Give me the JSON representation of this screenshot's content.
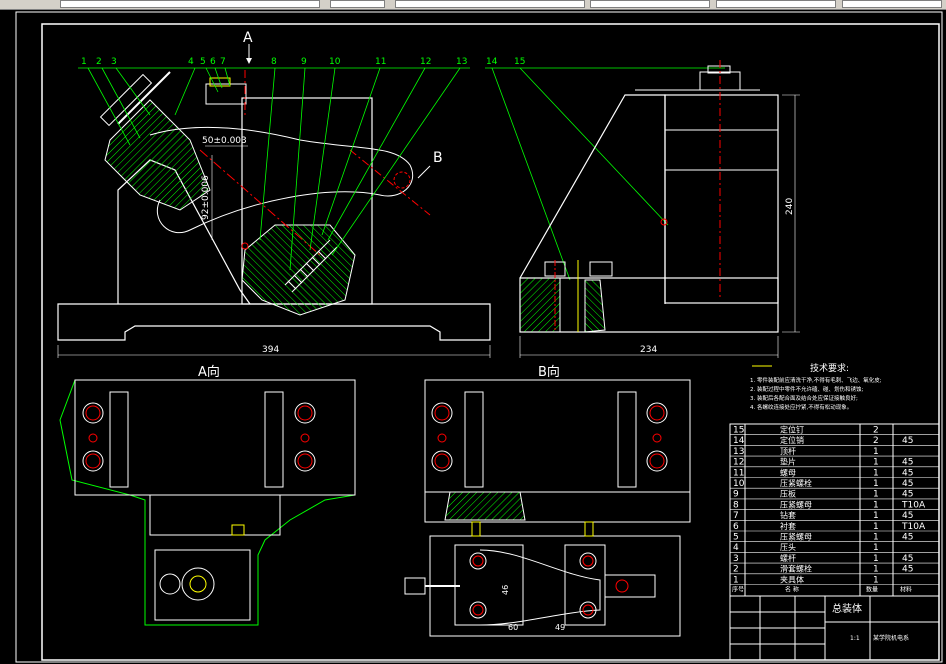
{
  "views": {
    "view_a_arrow_label": "A",
    "view_b_arrow_label": "B",
    "view_a_title": "A向",
    "view_b_title": "B向"
  },
  "balloons": [
    "1",
    "2",
    "3",
    "4",
    "5",
    "6",
    "7",
    "8",
    "9",
    "10",
    "11",
    "12",
    "13",
    "14",
    "15"
  ],
  "dimensions": {
    "front_width": "394",
    "side_width": "234",
    "side_height": "240",
    "lever_x": "50±0.003",
    "lever_y": "92±0.006",
    "b_view_46": "46",
    "b_view_60": "60",
    "b_view_49": "49"
  },
  "tech_requirements": {
    "title": "技术要求:",
    "lines": [
      "1. 零件装配前应清洗干净,不得有毛刺、飞边、氧化皮;",
      "2. 装配过程中零件不允许磕、碰、划伤和锈蚀;",
      "3. 装配后各配合面及结合处应保证接触良好;",
      "4. 各螺纹连接处应拧紧,不得有松动现象。"
    ]
  },
  "parts_list": {
    "rows": [
      {
        "no": "15",
        "name": "定位钉",
        "qty": "2",
        "mat": ""
      },
      {
        "no": "14",
        "name": "定位销",
        "qty": "2",
        "mat": "45"
      },
      {
        "no": "13",
        "name": "顶杆",
        "qty": "1",
        "mat": ""
      },
      {
        "no": "12",
        "name": "垫片",
        "qty": "1",
        "mat": "45"
      },
      {
        "no": "11",
        "name": "螺母",
        "qty": "1",
        "mat": "45"
      },
      {
        "no": "10",
        "name": "压紧螺栓",
        "qty": "1",
        "mat": "45"
      },
      {
        "no": "9",
        "name": "压板",
        "qty": "1",
        "mat": "45"
      },
      {
        "no": "8",
        "name": "压紧螺母",
        "qty": "1",
        "mat": "T10A"
      },
      {
        "no": "7",
        "name": "钻套",
        "qty": "1",
        "mat": "45"
      },
      {
        "no": "6",
        "name": "衬套",
        "qty": "1",
        "mat": "T10A"
      },
      {
        "no": "5",
        "name": "压紧螺母",
        "qty": "1",
        "mat": "45"
      },
      {
        "no": "4",
        "name": "压头",
        "qty": "1",
        "mat": ""
      },
      {
        "no": "3",
        "name": "螺杆",
        "qty": "1",
        "mat": "45"
      },
      {
        "no": "2",
        "name": "滑套螺栓",
        "qty": "1",
        "mat": "45"
      },
      {
        "no": "1",
        "name": "夹具体",
        "qty": "1",
        "mat": ""
      }
    ],
    "header": {
      "no": "序号",
      "name": "名 称",
      "qty": "数量",
      "mat": "材料"
    }
  },
  "title_block": {
    "drawing_name": "总装体",
    "school": "某学院机电系",
    "scale": "1:1"
  },
  "colors": {
    "background": "#000000",
    "frame": "#ffffff",
    "callout": "#00ff00",
    "part_outline": "#ffffff",
    "hatch": "#00ff00",
    "centerline": "#ff0000",
    "fastener": "#ffff00",
    "text_yellow": "#ffff00"
  }
}
